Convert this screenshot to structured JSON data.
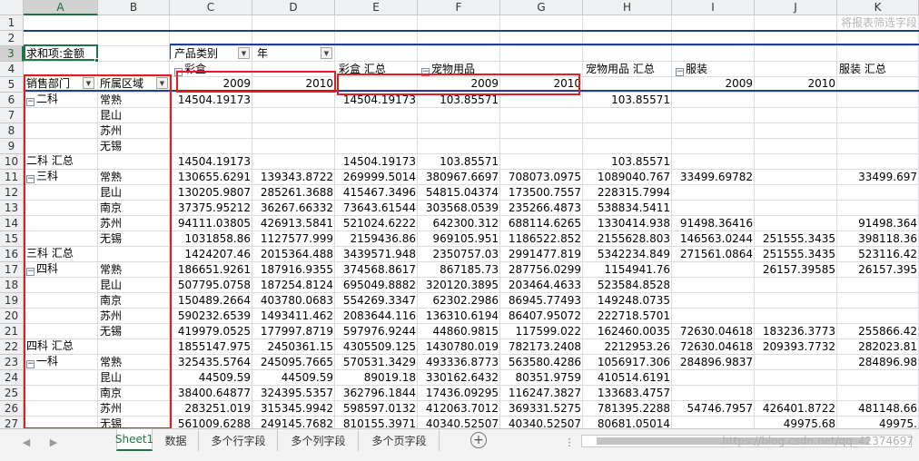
{
  "columns": [
    "A",
    "B",
    "C",
    "D",
    "E",
    "F",
    "G",
    "H",
    "I",
    "J",
    "K"
  ],
  "rows": [
    "1",
    "2",
    "3",
    "4",
    "5",
    "6",
    "7",
    "8",
    "9",
    "10",
    "11",
    "12",
    "13",
    "14",
    "15",
    "16",
    "17",
    "18",
    "19",
    "20",
    "21",
    "22",
    "23",
    "24",
    "25",
    "26",
    "27"
  ],
  "pivot": {
    "filter_hint": "将报表筛选字段",
    "value_label": "求和项:金额",
    "col_field_1": "产品类别",
    "col_field_2": "年",
    "row_field_1": "销售部门",
    "row_field_2": "所属区域",
    "cat_caipiao": "彩盒",
    "cat_caipiao_total": "彩盒 汇总",
    "cat_pet": "宠物用品",
    "cat_pet_total": "宠物用品 汇总",
    "cat_cloth": "服装",
    "cat_cloth_total": "服装 汇总",
    "year_2009": "2009",
    "year_2010": "2010",
    "dept_2": "二科",
    "dept_2_total": "二科 汇总",
    "dept_3": "三科",
    "dept_3_total": "三科 汇总",
    "dept_4": "四科",
    "dept_4_total": "四科 汇总",
    "dept_1": "一科"
  },
  "data_rows": [
    {
      "row": "6",
      "b": "常熟",
      "c": "14504.19173",
      "d": "",
      "e": "14504.19173",
      "f": "103.85571",
      "g": "",
      "h": "103.85571",
      "i": "",
      "j": "",
      "k": ""
    },
    {
      "row": "7",
      "b": "昆山",
      "c": "",
      "d": "",
      "e": "",
      "f": "",
      "g": "",
      "h": "",
      "i": "",
      "j": "",
      "k": ""
    },
    {
      "row": "8",
      "b": "苏州",
      "c": "",
      "d": "",
      "e": "",
      "f": "",
      "g": "",
      "h": "",
      "i": "",
      "j": "",
      "k": ""
    },
    {
      "row": "9",
      "b": "无锡",
      "c": "",
      "d": "",
      "e": "",
      "f": "",
      "g": "",
      "h": "",
      "i": "",
      "j": "",
      "k": ""
    },
    {
      "row": "10",
      "b": "",
      "c": "14504.19173",
      "d": "",
      "e": "14504.19173",
      "f": "103.85571",
      "g": "",
      "h": "103.85571",
      "i": "",
      "j": "",
      "k": ""
    },
    {
      "row": "11",
      "b": "常熟",
      "c": "130655.6291",
      "d": "139343.8722",
      "e": "269999.5014",
      "f": "380967.6697",
      "g": "708073.0975",
      "h": "1089040.767",
      "i": "33499.69782",
      "j": "",
      "k": "33499.697"
    },
    {
      "row": "12",
      "b": "昆山",
      "c": "130205.9807",
      "d": "285261.3688",
      "e": "415467.3496",
      "f": "54815.04374",
      "g": "173500.7557",
      "h": "228315.7994",
      "i": "",
      "j": "",
      "k": ""
    },
    {
      "row": "13",
      "b": "南京",
      "c": "37375.95212",
      "d": "36267.66332",
      "e": "73643.61544",
      "f": "303568.0539",
      "g": "235266.4873",
      "h": "538834.5411",
      "i": "",
      "j": "",
      "k": ""
    },
    {
      "row": "14",
      "b": "苏州",
      "c": "94111.03805",
      "d": "426913.5841",
      "e": "521024.6222",
      "f": "642300.312",
      "g": "688114.6265",
      "h": "1330414.938",
      "i": "91498.36416",
      "j": "",
      "k": "91498.364"
    },
    {
      "row": "15",
      "b": "无锡",
      "c": "1031858.86",
      "d": "1127577.999",
      "e": "2159436.86",
      "f": "969105.951",
      "g": "1186522.852",
      "h": "2155628.803",
      "i": "146563.0244",
      "j": "251555.3435",
      "k": "398118.36"
    },
    {
      "row": "16",
      "b": "",
      "c": "1424207.46",
      "d": "2015364.488",
      "e": "3439571.948",
      "f": "2350757.03",
      "g": "2991477.819",
      "h": "5342234.849",
      "i": "271561.0864",
      "j": "251555.3435",
      "k": "523116.42"
    },
    {
      "row": "17",
      "b": "常熟",
      "c": "186651.9261",
      "d": "187916.9355",
      "e": "374568.8617",
      "f": "867185.73",
      "g": "287756.0299",
      "h": "1154941.76",
      "i": "",
      "j": "26157.39585",
      "k": "26157.395"
    },
    {
      "row": "18",
      "b": "昆山",
      "c": "507795.0758",
      "d": "187254.8124",
      "e": "695049.8882",
      "f": "320120.3895",
      "g": "203464.4633",
      "h": "523584.8528",
      "i": "",
      "j": "",
      "k": ""
    },
    {
      "row": "19",
      "b": "南京",
      "c": "150489.2664",
      "d": "403780.0683",
      "e": "554269.3347",
      "f": "62302.2986",
      "g": "86945.77493",
      "h": "149248.0735",
      "i": "",
      "j": "",
      "k": ""
    },
    {
      "row": "20",
      "b": "苏州",
      "c": "590232.6539",
      "d": "1493411.462",
      "e": "2083644.116",
      "f": "136310.6194",
      "g": "86407.95072",
      "h": "222718.5701",
      "i": "",
      "j": "",
      "k": ""
    },
    {
      "row": "21",
      "b": "无锡",
      "c": "419979.0525",
      "d": "177997.8719",
      "e": "597976.9244",
      "f": "44860.9815",
      "g": "117599.022",
      "h": "162460.0035",
      "i": "72630.04618",
      "j": "183236.3773",
      "k": "255866.42"
    },
    {
      "row": "22",
      "b": "",
      "c": "1855147.975",
      "d": "2450361.15",
      "e": "4305509.125",
      "f": "1430780.019",
      "g": "782173.2408",
      "h": "2212953.26",
      "i": "72630.04618",
      "j": "209393.7732",
      "k": "282023.81"
    },
    {
      "row": "23",
      "b": "常熟",
      "c": "325435.5764",
      "d": "245095.7665",
      "e": "570531.3429",
      "f": "493336.8773",
      "g": "563580.4286",
      "h": "1056917.306",
      "i": "284896.9837",
      "j": "",
      "k": "284896.98"
    },
    {
      "row": "24",
      "b": "昆山",
      "c": "44509.59",
      "d": "44509.59",
      "e": "89019.18",
      "f": "330162.6432",
      "g": "80351.9759",
      "h": "410514.6191",
      "i": "",
      "j": "",
      "k": ""
    },
    {
      "row": "25",
      "b": "南京",
      "c": "38400.64877",
      "d": "324395.5357",
      "e": "362796.1844",
      "f": "17436.09295",
      "g": "116247.3827",
      "h": "133683.4757",
      "i": "",
      "j": "",
      "k": ""
    },
    {
      "row": "26",
      "b": "苏州",
      "c": "283251.019",
      "d": "315345.9942",
      "e": "598597.0132",
      "f": "412063.7012",
      "g": "369331.5275",
      "h": "781395.2288",
      "i": "54746.7957",
      "j": "426401.8722",
      "k": "481148.66"
    },
    {
      "row": "27",
      "b": "无锡",
      "c": "561009.6288",
      "d": "249145.7682",
      "e": "810155.3971",
      "f": "40340.52507",
      "g": "40340.52507",
      "h": "80681.05014",
      "i": "",
      "j": "49975.68",
      "k": "49975."
    }
  ],
  "tabs": [
    "Sheet1",
    "数据",
    "多个行字段",
    "多个列字段",
    "多个页字段"
  ],
  "watermark": "https://blog.csdn.net/qq_42374697",
  "colors": {
    "accent": "#217346",
    "pivot_line": "#1f3f96",
    "highlight": "#e02020",
    "header_bg": "#eef0f2"
  },
  "icons": {
    "prev": "triangle-left-icon",
    "next": "triangle-right-icon",
    "add": "plus-circle-icon",
    "more": "ellipsis-icon"
  }
}
